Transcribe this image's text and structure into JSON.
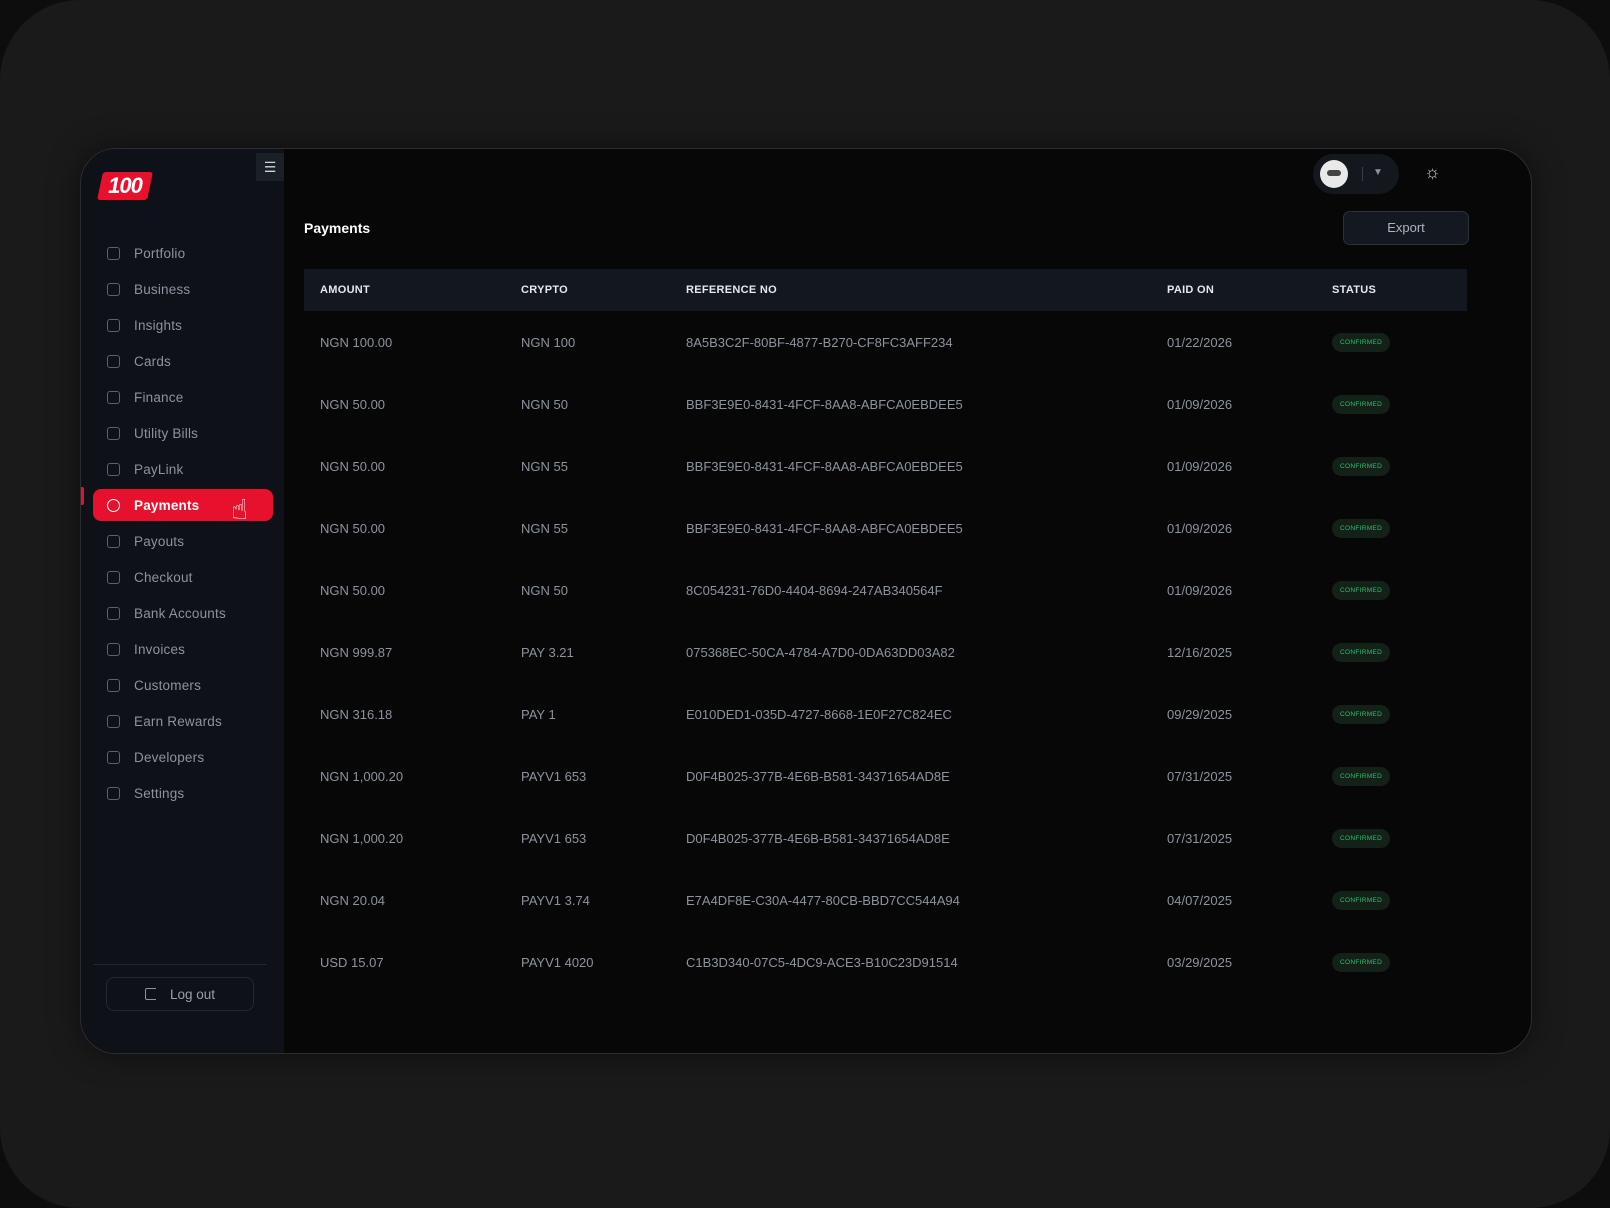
{
  "brand": {
    "logo_text": "100",
    "accent": "#e8112d"
  },
  "sidebar": {
    "collapse_icon": "hamburger-icon",
    "items": [
      {
        "label": "Portfolio",
        "icon": "portfolio-icon"
      },
      {
        "label": "Business",
        "icon": "business-icon"
      },
      {
        "label": "Insights",
        "icon": "insights-icon"
      },
      {
        "label": "Cards",
        "icon": "cards-icon"
      },
      {
        "label": "Finance",
        "icon": "finance-icon"
      },
      {
        "label": "Utility Bills",
        "icon": "utility-bills-icon"
      },
      {
        "label": "PayLink",
        "icon": "paylink-icon"
      },
      {
        "label": "Payments",
        "icon": "payments-icon",
        "active": true
      },
      {
        "label": "Payouts",
        "icon": "payouts-icon"
      },
      {
        "label": "Checkout",
        "icon": "checkout-icon"
      },
      {
        "label": "Bank Accounts",
        "icon": "bank-icon"
      },
      {
        "label": "Invoices",
        "icon": "invoices-icon"
      },
      {
        "label": "Customers",
        "icon": "customers-icon"
      },
      {
        "label": "Earn Rewards",
        "icon": "rewards-icon"
      },
      {
        "label": "Developers",
        "icon": "developers-icon"
      },
      {
        "label": "Settings",
        "icon": "settings-icon"
      }
    ],
    "logout_label": "Log out"
  },
  "header": {
    "theme_icon": "sun-icon"
  },
  "main": {
    "title": "Payments",
    "export_label": "Export",
    "columns": [
      "AMOUNT",
      "CRYPTO",
      "REFERENCE NO",
      "PAID ON",
      "STATUS"
    ],
    "rows": [
      [
        "NGN 100.00",
        "NGN 100",
        "8A5B3C2F-80BF-4877-B270-CF8FC3AFF234",
        "01/22/2026",
        "CONFIRMED"
      ],
      [
        "NGN 50.00",
        "NGN 50",
        "BBF3E9E0-8431-4FCF-8AA8-ABFCA0EBDEE5",
        "01/09/2026",
        "CONFIRMED"
      ],
      [
        "NGN 50.00",
        "NGN 55",
        "BBF3E9E0-8431-4FCF-8AA8-ABFCA0EBDEE5",
        "01/09/2026",
        "CONFIRMED"
      ],
      [
        "NGN 50.00",
        "NGN 55",
        "BBF3E9E0-8431-4FCF-8AA8-ABFCA0EBDEE5",
        "01/09/2026",
        "CONFIRMED"
      ],
      [
        "NGN 50.00",
        "NGN 50",
        "8C054231-76D0-4404-8694-247AB340564F",
        "01/09/2026",
        "CONFIRMED"
      ],
      [
        "NGN 999.87",
        "PAY 3.21",
        "075368EC-50CA-4784-A7D0-0DA63DD03A82",
        "12/16/2025",
        "CONFIRMED"
      ],
      [
        "NGN 316.18",
        "PAY 1",
        "E010DED1-035D-4727-8668-1E0F27C824EC",
        "09/29/2025",
        "CONFIRMED"
      ],
      [
        "NGN 1,000.20",
        "PAYV1 653",
        "D0F4B025-377B-4E6B-B581-34371654AD8E",
        "07/31/2025",
        "CONFIRMED"
      ],
      [
        "NGN 1,000.20",
        "PAYV1 653",
        "D0F4B025-377B-4E6B-B581-34371654AD8E",
        "07/31/2025",
        "CONFIRMED"
      ],
      [
        "NGN 20.04",
        "PAYV1 3.74",
        "E7A4DF8E-C30A-4477-80CB-BBD7CC544A94",
        "04/07/2025",
        "CONFIRMED"
      ],
      [
        "USD 15.07",
        "PAYV1 4020",
        "C1B3D340-07C5-4DC9-ACE3-B10C23D91514",
        "03/29/2025",
        "CONFIRMED"
      ]
    ]
  }
}
